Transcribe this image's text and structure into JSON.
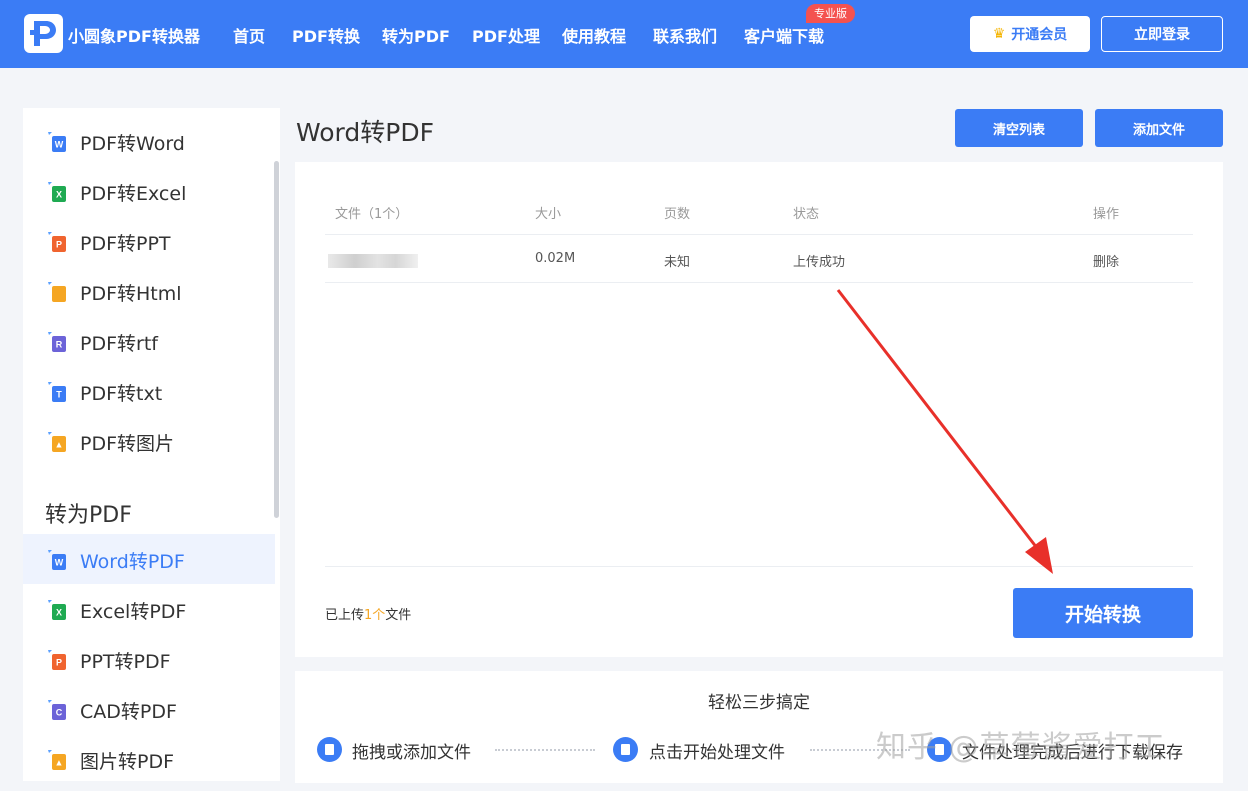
{
  "header": {
    "brand": "小圆象PDF转换器",
    "nav": [
      "首页",
      "PDF转换",
      "转为PDF",
      "PDF处理",
      "使用教程",
      "联系我们",
      "客户端下载"
    ],
    "pro_badge": "专业版",
    "vip_label": "开通会员",
    "login_label": "立即登录"
  },
  "sidebar": {
    "from_pdf": [
      {
        "label": "PDF转Word",
        "icon": "word-icon",
        "color": "#3b7cf5",
        "letter": "W"
      },
      {
        "label": "PDF转Excel",
        "icon": "excel-icon",
        "color": "#1faa52",
        "letter": "X"
      },
      {
        "label": "PDF转PPT",
        "icon": "ppt-icon",
        "color": "#f0642f",
        "letter": "P"
      },
      {
        "label": "PDF转Html",
        "icon": "html-icon",
        "color": "#f5a623",
        "letter": "</>"
      },
      {
        "label": "PDF转rtf",
        "icon": "rtf-icon",
        "color": "#6c63d8",
        "letter": "R"
      },
      {
        "label": "PDF转txt",
        "icon": "txt-icon",
        "color": "#3b7cf5",
        "letter": "T"
      },
      {
        "label": "PDF转图片",
        "icon": "image-icon",
        "color": "#f5a623",
        "letter": "▲"
      }
    ],
    "to_pdf_heading": "转为PDF",
    "to_pdf": [
      {
        "label": "Word转PDF",
        "icon": "word-icon",
        "color": "#3b7cf5",
        "letter": "W",
        "active": true
      },
      {
        "label": "Excel转PDF",
        "icon": "excel-icon",
        "color": "#1faa52",
        "letter": "X"
      },
      {
        "label": "PPT转PDF",
        "icon": "ppt-icon",
        "color": "#f0642f",
        "letter": "P"
      },
      {
        "label": "CAD转PDF",
        "icon": "cad-icon",
        "color": "#6c63d8",
        "letter": "C"
      },
      {
        "label": "图片转PDF",
        "icon": "image-icon",
        "color": "#f5a623",
        "letter": "▲"
      }
    ]
  },
  "main": {
    "title": "Word转PDF",
    "clear_label": "清空列表",
    "add_label": "添加文件",
    "columns": {
      "file": "文件（1个）",
      "size": "大小",
      "pages": "页数",
      "status": "状态",
      "action": "操作"
    },
    "rows": [
      {
        "size": "0.02M",
        "pages": "未知",
        "status": "上传成功",
        "action": "删除"
      }
    ],
    "count_prefix": "已上传",
    "count_value": "1个",
    "count_suffix": "文件",
    "start_label": "开始转换"
  },
  "steps": {
    "title": "轻松三步搞定",
    "items": [
      "拖拽或添加文件",
      "点击开始处理文件",
      "文件处理完成后进行下载保存"
    ]
  },
  "watermark": "知乎 @草莓酱爱打工",
  "colors": {
    "primary": "#3b7cf5",
    "arrow": "#e8302a",
    "accent_count": "#f5a623"
  }
}
